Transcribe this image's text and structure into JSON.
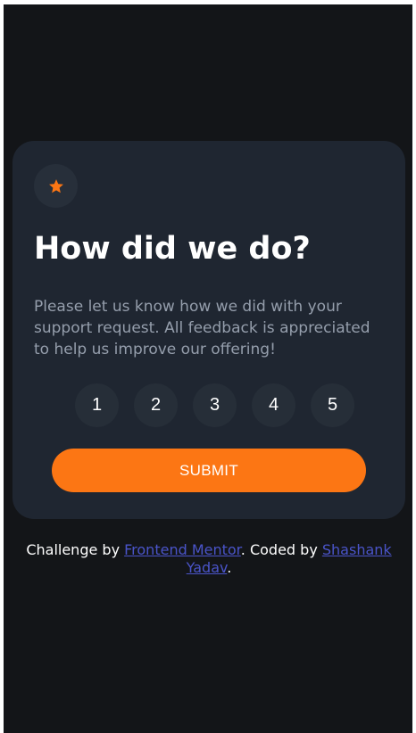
{
  "card": {
    "title": "How did we do?",
    "description": "Please let us know how we did with your support request. All feedback is appreciated to help us improve our offering!",
    "ratings": [
      "1",
      "2",
      "3",
      "4",
      "5"
    ],
    "submit_label": "SUBMIT"
  },
  "attribution": {
    "prefix": "Challenge by ",
    "challenge_link": "Frontend Mentor",
    "middle": ". Coded by ",
    "author_link": "Shashank Yadav",
    "suffix": "."
  },
  "icons": {
    "badge": "star-icon"
  },
  "colors": {
    "background": "#131518",
    "card": "#1f2631",
    "accent": "#fc7614",
    "rating_bg": "#262e38",
    "muted_text": "#959eac",
    "link": "#4a54c9"
  }
}
